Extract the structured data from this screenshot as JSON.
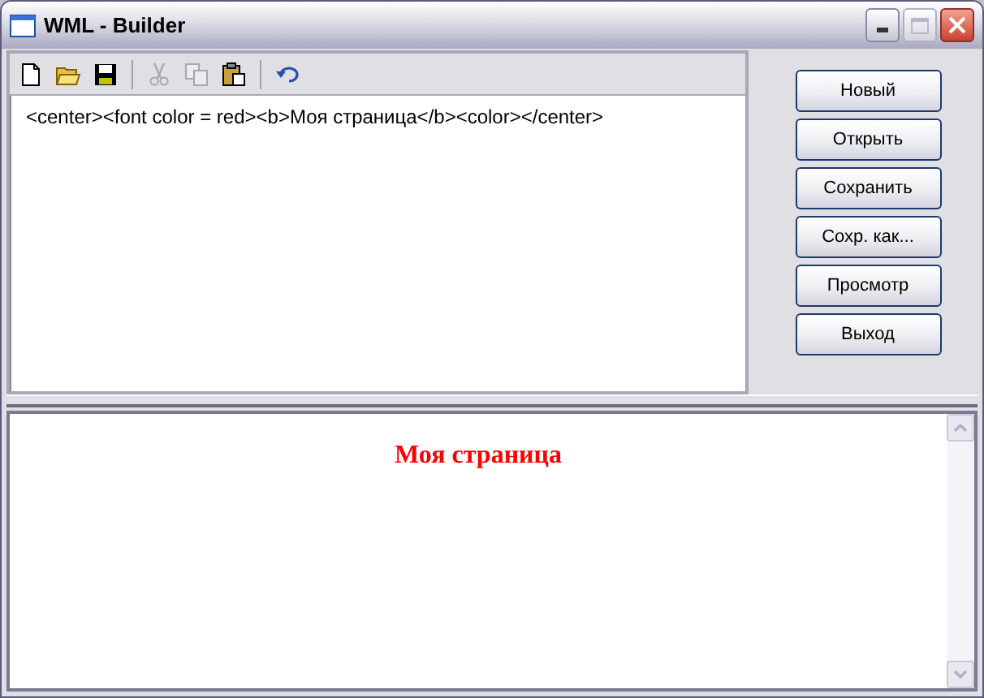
{
  "window": {
    "title": "WML - Builder"
  },
  "toolbar": [
    {
      "kind": "new",
      "disabled": false
    },
    {
      "kind": "open",
      "disabled": false
    },
    {
      "kind": "save",
      "disabled": false
    },
    {
      "kind": "separator"
    },
    {
      "kind": "cut",
      "disabled": true
    },
    {
      "kind": "copy",
      "disabled": true
    },
    {
      "kind": "paste",
      "disabled": false
    },
    {
      "kind": "separator"
    },
    {
      "kind": "undo",
      "disabled": false
    }
  ],
  "editor": {
    "value": "<center><font color = red><b>Моя страница</b><color></center>"
  },
  "buttons": [
    "Новый",
    "Открыть",
    "Сохранить",
    "Сохр. как...",
    "Просмотр",
    "Выход"
  ],
  "preview": {
    "heading": "Моя страница"
  }
}
